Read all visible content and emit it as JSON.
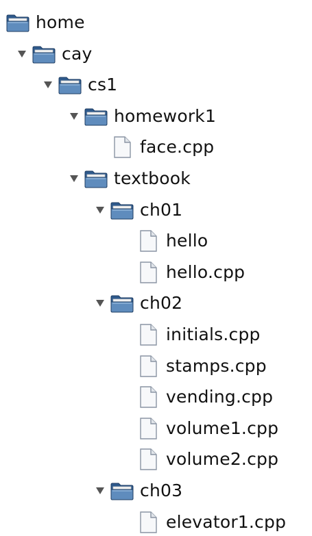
{
  "tree": {
    "nodes": [
      {
        "name": "home",
        "type": "folder",
        "depth": 0,
        "expanded": true,
        "toggle": false,
        "icon": "folder-icon"
      },
      {
        "name": "cay",
        "type": "folder",
        "depth": 1,
        "expanded": true,
        "toggle": true,
        "icon": "folder-icon"
      },
      {
        "name": "cs1",
        "type": "folder",
        "depth": 2,
        "expanded": true,
        "toggle": true,
        "icon": "folder-icon"
      },
      {
        "name": "homework1",
        "type": "folder",
        "depth": 3,
        "expanded": true,
        "toggle": true,
        "icon": "folder-icon"
      },
      {
        "name": "face.cpp",
        "type": "file",
        "depth": 4,
        "toggle": false,
        "icon": "file-icon"
      },
      {
        "name": "textbook",
        "type": "folder",
        "depth": 3,
        "expanded": true,
        "toggle": true,
        "icon": "folder-icon"
      },
      {
        "name": "ch01",
        "type": "folder",
        "depth": 4,
        "expanded": true,
        "toggle": true,
        "icon": "folder-icon"
      },
      {
        "name": "hello",
        "type": "file",
        "depth": 5,
        "toggle": false,
        "icon": "file-icon"
      },
      {
        "name": "hello.cpp",
        "type": "file",
        "depth": 5,
        "toggle": false,
        "icon": "file-icon"
      },
      {
        "name": "ch02",
        "type": "folder",
        "depth": 4,
        "expanded": true,
        "toggle": true,
        "icon": "folder-icon"
      },
      {
        "name": "initials.cpp",
        "type": "file",
        "depth": 5,
        "toggle": false,
        "icon": "file-icon"
      },
      {
        "name": "stamps.cpp",
        "type": "file",
        "depth": 5,
        "toggle": false,
        "icon": "file-icon"
      },
      {
        "name": "vending.cpp",
        "type": "file",
        "depth": 5,
        "toggle": false,
        "icon": "file-icon"
      },
      {
        "name": "volume1.cpp",
        "type": "file",
        "depth": 5,
        "toggle": false,
        "icon": "file-icon"
      },
      {
        "name": "volume2.cpp",
        "type": "file",
        "depth": 5,
        "toggle": false,
        "icon": "file-icon"
      },
      {
        "name": "ch03",
        "type": "folder",
        "depth": 4,
        "expanded": true,
        "toggle": true,
        "icon": "folder-icon"
      },
      {
        "name": "elevator1.cpp",
        "type": "file",
        "depth": 5,
        "toggle": false,
        "icon": "file-icon"
      }
    ]
  },
  "colors": {
    "text": "#111111",
    "toggle": "#555555",
    "folder_body": "#2f5a8c",
    "folder_front": "#5f8cbd",
    "folder_paper": "#f2f2f2",
    "file_page": "#f7f8fa",
    "file_border": "#8a94a3"
  }
}
